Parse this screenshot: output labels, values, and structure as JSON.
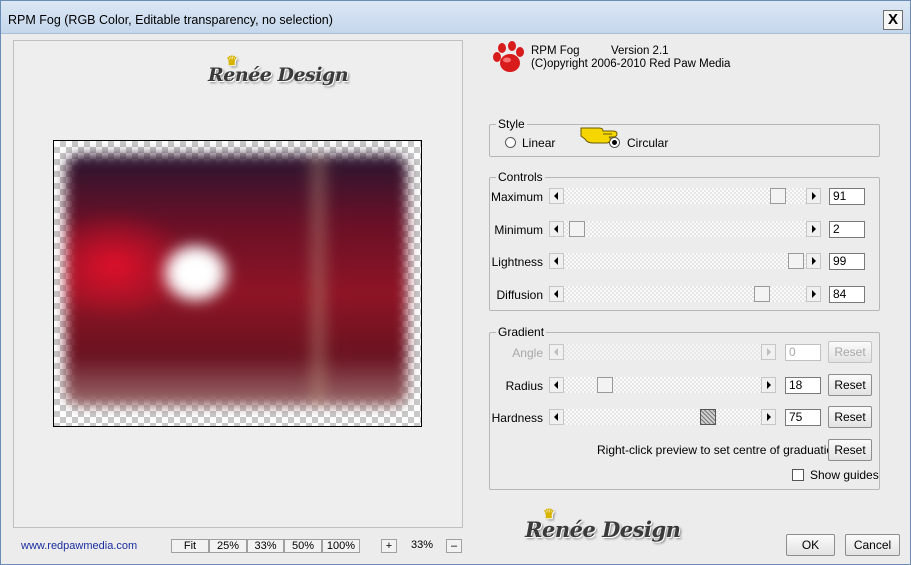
{
  "window": {
    "title": "RPM Fog (RGB Color, Editable transparency, no selection)",
    "close_label": "X"
  },
  "watermark": {
    "text": "Renée Design"
  },
  "plugin": {
    "name": "RPM Fog",
    "version": "Version 2.1",
    "copyright": "(C)opyright 2006-2010 Red Paw Media"
  },
  "style_group": {
    "legend": "Style",
    "options": [
      {
        "label": "Linear",
        "selected": false
      },
      {
        "label": "Circular",
        "selected": true
      }
    ]
  },
  "controls_group": {
    "legend": "Controls",
    "sliders": [
      {
        "label": "Maximum",
        "value": "91",
        "fraction": 0.91
      },
      {
        "label": "Minimum",
        "value": "2",
        "fraction": 0.02
      },
      {
        "label": "Lightness",
        "value": "99",
        "fraction": 0.99
      },
      {
        "label": "Diffusion",
        "value": "84",
        "fraction": 0.84
      }
    ]
  },
  "gradient_group": {
    "legend": "Gradient",
    "sliders": [
      {
        "label": "Angle",
        "value": "0",
        "disabled": true,
        "reset": "Reset"
      },
      {
        "label": "Radius",
        "value": "18",
        "fraction": 0.18,
        "disabled": false,
        "reset": "Reset"
      },
      {
        "label": "Hardness",
        "value": "75",
        "fraction": 0.75,
        "disabled": false,
        "reset": "Reset"
      }
    ],
    "hint": "Right-click preview to set centre of graduation",
    "hint_reset": "Reset",
    "show_guides_label": "Show guides",
    "show_guides_checked": false
  },
  "footer": {
    "link": "www.redpawmedia.com",
    "zoom_buttons": [
      "Fit",
      "25%",
      "33%",
      "50%",
      "100%"
    ],
    "zoom_plus": "+",
    "zoom_value": "33%",
    "zoom_minus": "–",
    "ok": "OK",
    "cancel": "Cancel"
  },
  "colors": {
    "accent": "#d81b1b",
    "link": "#1a2ea0",
    "preview_red": "#8e1425"
  }
}
